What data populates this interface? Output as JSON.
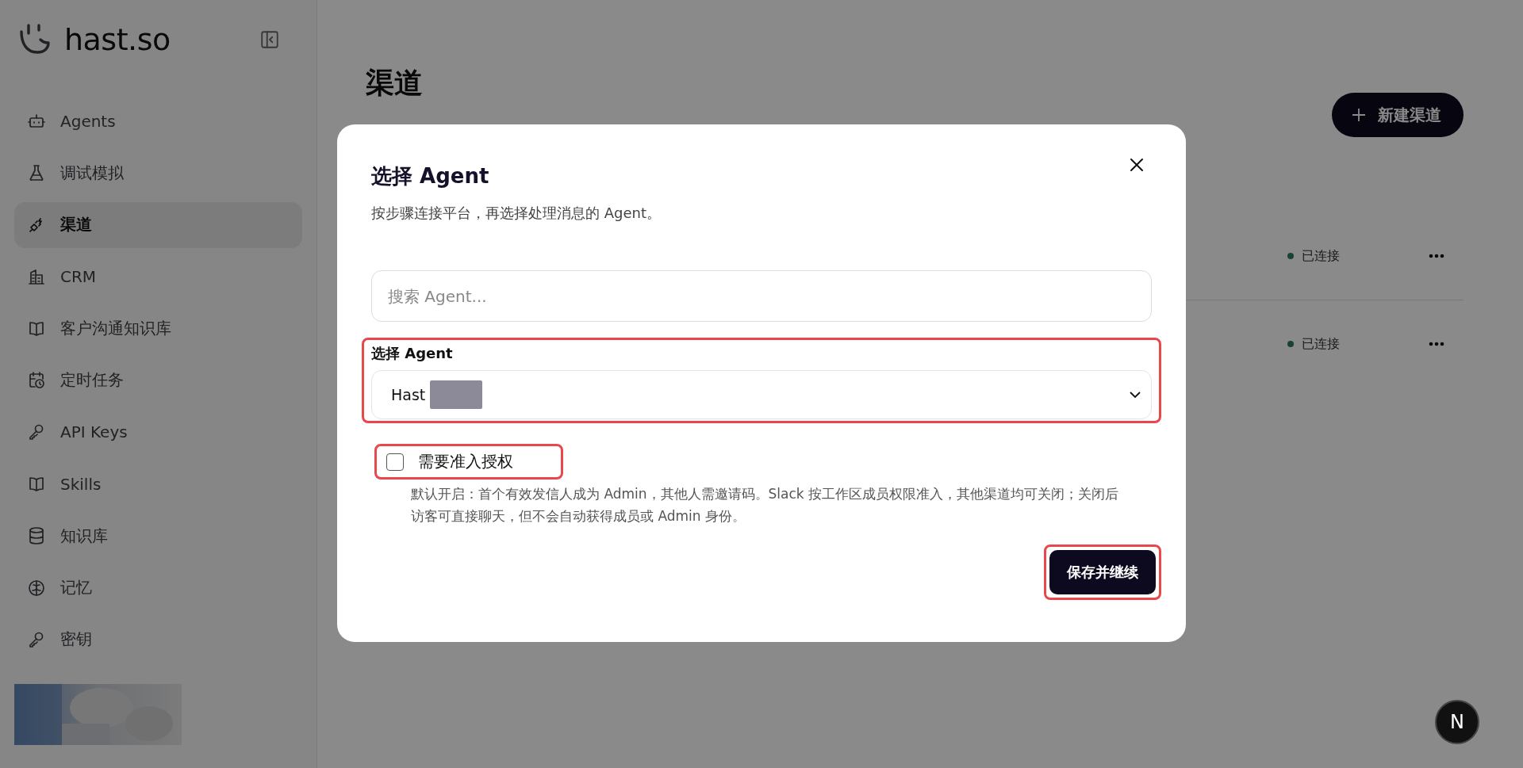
{
  "sidebar": {
    "logo": "hast.so",
    "items": [
      {
        "label": "Agents",
        "selected": false
      },
      {
        "label": "调试模拟",
        "selected": false
      },
      {
        "label": "渠道",
        "selected": true
      },
      {
        "label": "CRM",
        "selected": false
      },
      {
        "label": "客户沟通知识库",
        "selected": false
      },
      {
        "label": "定时任务",
        "selected": false
      },
      {
        "label": "API Keys",
        "selected": false
      },
      {
        "label": "Skills",
        "selected": false
      },
      {
        "label": "知识库",
        "selected": false
      },
      {
        "label": "记忆",
        "selected": false
      },
      {
        "label": "密钥",
        "selected": false
      }
    ]
  },
  "page": {
    "title": "渠道",
    "new_button": "新建渠道",
    "channels": [
      {
        "status": "已连接",
        "connected": true
      },
      {
        "status": "已连接",
        "connected": true
      }
    ]
  },
  "dialog": {
    "title": "选择 Agent",
    "description": "按步骤连接平台，再选择处理消息的 Agent。",
    "search": {
      "placeholder": "搜索 Agent..."
    },
    "select": {
      "label": "选择 Agent",
      "value": "Hast",
      "highlighted": true
    },
    "checkbox": {
      "label": "需要准入授权",
      "checked": false,
      "highlighted": true
    },
    "help": "默认开启：首个有效发信人成为 Admin，其他人需邀请码。Slack 按工作区成员权限准入，其他渠道均可关闭；关闭后访客可直接聊天，但不会自动获得成员或 Admin 身份。",
    "save_button": {
      "label": "保存并继续",
      "highlighted": true
    }
  },
  "dev_badge": "N"
}
